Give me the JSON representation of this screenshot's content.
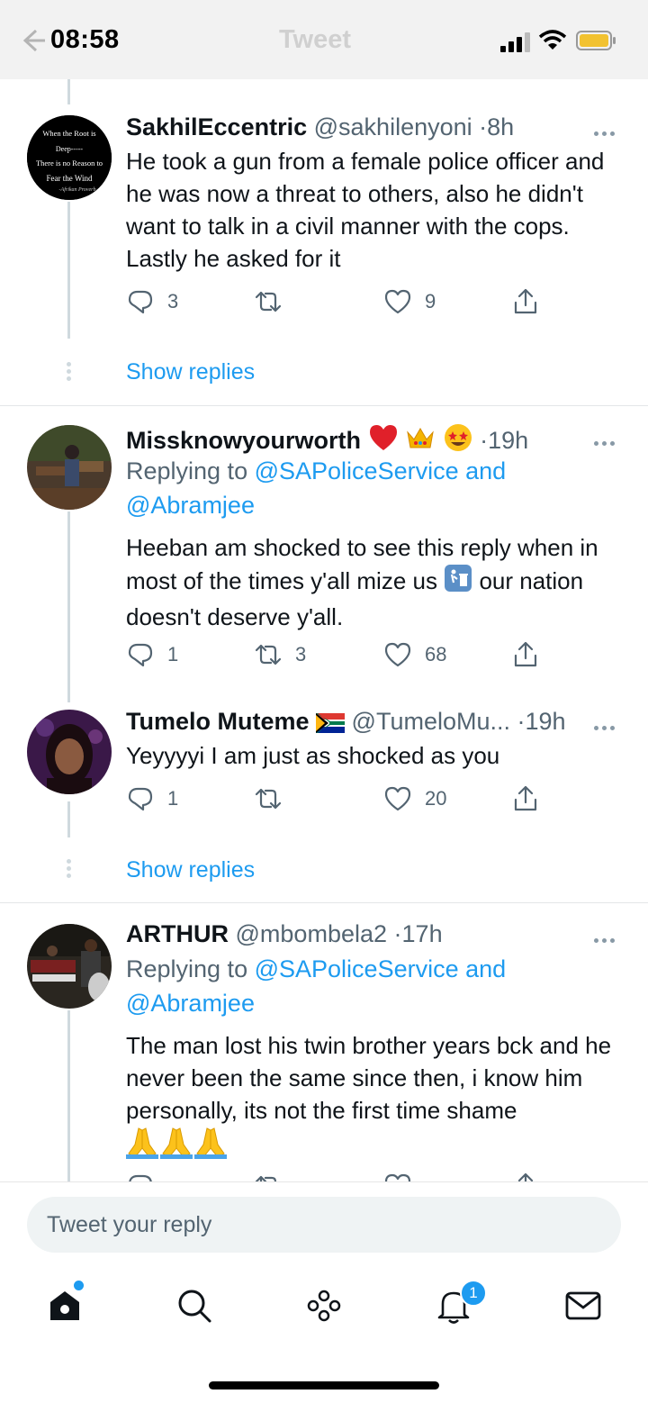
{
  "status_bar": {
    "time": "08:58",
    "ghost_title": "Tweet"
  },
  "tweets": [
    {
      "name": "SakhilEccentric",
      "handle": "@sakhilenyoni",
      "time": "8h",
      "avatar_text": [
        "When the Root is",
        "Deep-----",
        "There is no Reason to",
        "Fear the Wind",
        "-Afrikan Proverb"
      ],
      "text": "He took a gun from a female police officer and he was now a threat to others, also he didn't want to talk in a civil manner with the cops. Lastly he asked for it",
      "replies": "3",
      "retweets": "",
      "likes": "9"
    },
    {
      "name": "Missknowyourworth",
      "handle": "",
      "time": "19h",
      "replying_prefix": "Replying to",
      "replying_to": "@SAPoliceService and",
      "replying_to_2": "@Abramjee",
      "text": "Heeban am shocked to see this reply when in most of the times y'all mize us",
      "text_after": "our nation doesn't deserve y'all.",
      "replies": "1",
      "retweets": "3",
      "likes": "68"
    },
    {
      "name": "Tumelo Muteme",
      "handle": "@TumeloMu...",
      "time": "19h",
      "text": "Yeyyyyi I am just as shocked as you",
      "replies": "1",
      "retweets": "",
      "likes": "20"
    },
    {
      "name": "ARTHUR",
      "handle": "@mbombela2",
      "time": "17h",
      "replying_prefix": "Replying to",
      "replying_to": "@SAPoliceService and",
      "replying_to_2": "@Abramjee",
      "text": "The man lost his twin brother years bck and he never been the same since then, i know him personally, its not the first time shame"
    }
  ],
  "show_replies_label": "Show replies",
  "reply_bar": {
    "placeholder": "Tweet your reply"
  },
  "tabbar": {
    "notifications_badge": "1"
  },
  "colors": {
    "accent": "#1d9bf0",
    "text": "#0f1419",
    "muted": "#536471"
  }
}
